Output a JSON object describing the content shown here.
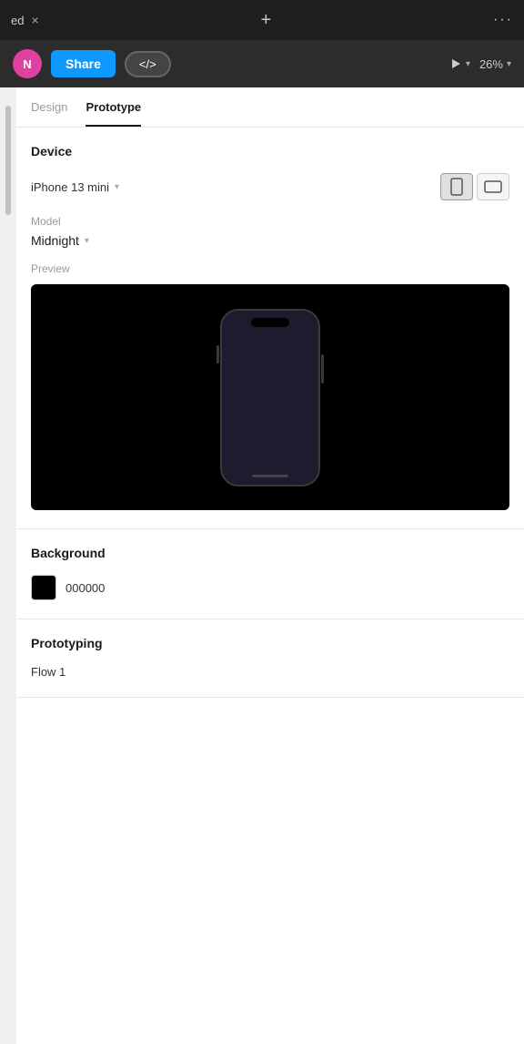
{
  "topbar": {
    "title": "ed",
    "close_label": "×",
    "add_label": "+",
    "dots_label": "···"
  },
  "toolbar": {
    "avatar_initials": "N",
    "share_label": "Share",
    "code_label": "</> ",
    "zoom_label": "26%"
  },
  "tabs": [
    {
      "id": "design",
      "label": "Design",
      "active": false
    },
    {
      "id": "prototype",
      "label": "Prototype",
      "active": true
    }
  ],
  "device_section": {
    "title": "Device",
    "device_name": "iPhone 13 mini",
    "orientation_portrait": "portrait",
    "orientation_landscape": "landscape"
  },
  "model_section": {
    "label": "Model",
    "value": "Midnight"
  },
  "preview_section": {
    "label": "Preview"
  },
  "background_section": {
    "title": "Background",
    "color_hex": "000000",
    "color_display": "#000000"
  },
  "prototyping_section": {
    "title": "Prototyping",
    "flow_label": "Flow 1"
  }
}
